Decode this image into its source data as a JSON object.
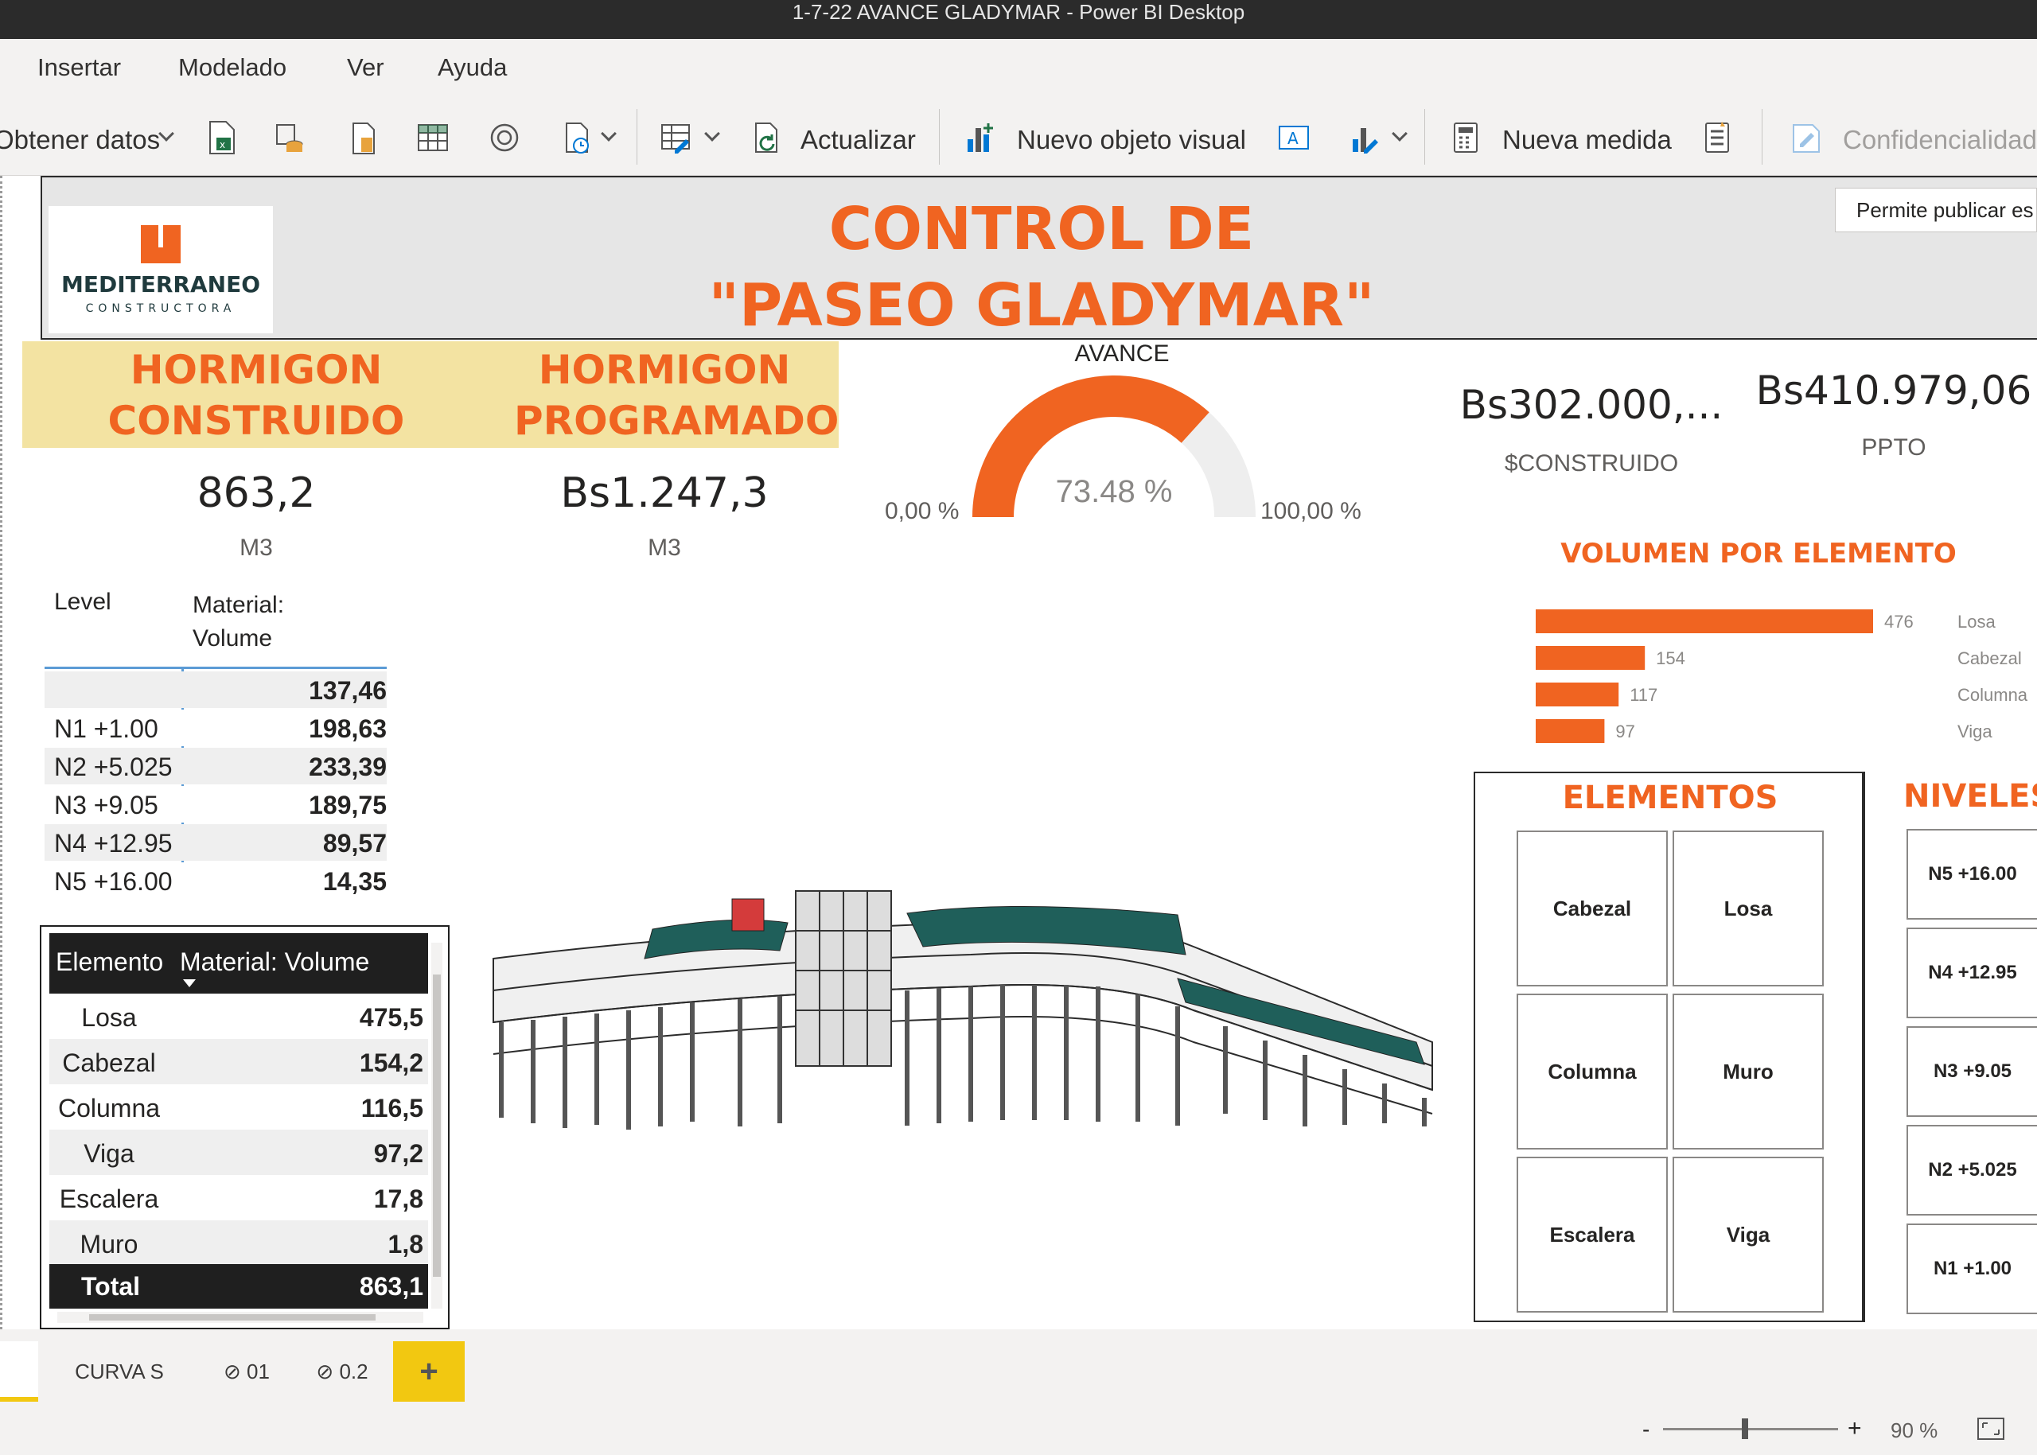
{
  "window": {
    "title": "1-7-22 AVANCE GLADYMAR - Power BI Desktop"
  },
  "menu": {
    "items": [
      "Insertar",
      "Modelado",
      "Ver",
      "Ayuda"
    ]
  },
  "ribbon": {
    "get_data": "Obtener datos",
    "refresh": "Actualizar",
    "new_visual": "Nuevo objeto visual",
    "new_measure": "Nueva medida",
    "sensitivity": "Confidencialidad",
    "icons": [
      "excel-icon",
      "sql-icon",
      "paste-icon",
      "table-icon",
      "dataverse-icon",
      "recent-sources-icon",
      "transform-data-icon",
      "refresh-icon",
      "new-visual-icon",
      "text-box-icon",
      "more-visuals-icon",
      "new-measure-icon",
      "quick-measure-icon",
      "sensitivity-icon"
    ]
  },
  "tooltip": {
    "text": "Permite publicar es"
  },
  "report": {
    "logo": {
      "name": "MEDITERRANEO",
      "sub": "CONSTRUCTORA"
    },
    "title_line1": "CONTROL DE",
    "title_line2": "\"PASEO GLADYMAR\"",
    "colors": {
      "accent": "#f06421",
      "yellow": "#f3e3a2",
      "dark": "#1f1f1f"
    },
    "kpi_built": {
      "title": "HORMIGON CONSTRUIDO",
      "value": "863,2",
      "unit": "M3"
    },
    "kpi_programmed": {
      "title": "HORMIGON PROGRAMADO",
      "value": "Bs1.247,3",
      "unit": "M3"
    },
    "gauge": {
      "title": "AVANCE",
      "value_label": "73.48 %",
      "value": 73.48,
      "min_label": "0,00 %",
      "max_label": "100,00 %"
    },
    "card_built_money": {
      "value": "Bs302.000,...",
      "label": "$CONSTRUIDO"
    },
    "card_budget": {
      "value": "Bs410.979,06",
      "label": "PPTO"
    },
    "level_table": {
      "headers": [
        "Level",
        "Material: Volume"
      ],
      "rows": [
        {
          "level": "",
          "volume": "137,46"
        },
        {
          "level": "N1 +1.00",
          "volume": "198,63"
        },
        {
          "level": "N2 +5.025",
          "volume": "233,39"
        },
        {
          "level": "N3 +9.05",
          "volume": "189,75"
        },
        {
          "level": "N4 +12.95",
          "volume": "89,57"
        },
        {
          "level": "N5 +16.00",
          "volume": "14,35"
        }
      ]
    },
    "element_table": {
      "headers": [
        "Elemento",
        "Material: Volume"
      ],
      "rows": [
        {
          "element": "Losa",
          "volume": "475,5"
        },
        {
          "element": "Cabezal",
          "volume": "154,2"
        },
        {
          "element": "Columna",
          "volume": "116,5"
        },
        {
          "element": "Viga",
          "volume": "97,2"
        },
        {
          "element": "Escalera",
          "volume": "17,8"
        },
        {
          "element": "Muro",
          "volume": "1,8"
        }
      ],
      "total_label": "Total",
      "total_value": "863,1"
    },
    "volume_chart_title": "VOLUMEN POR ELEMENTO",
    "slicer_elements": {
      "title": "ELEMENTOS",
      "items": [
        "Cabezal",
        "Losa",
        "Columna",
        "Muro",
        "Escalera",
        "Viga"
      ]
    },
    "slicer_levels": {
      "title": "NIVELES",
      "items": [
        "N5 +16.00",
        "N4 +12.95",
        "N3 +9.05",
        "N2 +5.025",
        "N1 +1.00"
      ]
    }
  },
  "chart_data": {
    "type": "bar",
    "title": "VOLUMEN POR ELEMENTO",
    "categories": [
      "Losa",
      "Cabezal",
      "Columna",
      "Viga"
    ],
    "values": [
      476,
      154,
      117,
      97
    ],
    "orientation": "horizontal",
    "color": "#f06421"
  },
  "tabs": {
    "items": [
      "CURVA S",
      "01",
      "0.2"
    ],
    "add": "+"
  },
  "status": {
    "zoom": "90 %",
    "zoom_minus": "-",
    "zoom_plus": "+",
    "zoom_level": 0.45
  }
}
